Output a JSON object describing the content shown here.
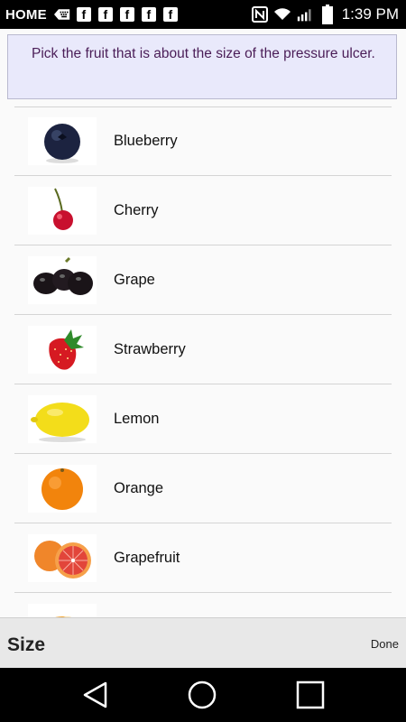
{
  "status_bar": {
    "home_label": "HOME",
    "time": "1:39 PM",
    "icons": [
      "keyboard-icon",
      "facebook-icon",
      "facebook-icon",
      "facebook-icon",
      "facebook-icon",
      "facebook-icon",
      "nfc-icon",
      "wifi-icon",
      "signal-icon",
      "battery-icon"
    ]
  },
  "prompt": {
    "text": "Pick the fruit that is about the size of the pressure ulcer."
  },
  "fruits": [
    {
      "label": "Blueberry",
      "icon": "blueberry-icon"
    },
    {
      "label": "Cherry",
      "icon": "cherry-icon"
    },
    {
      "label": "Grape",
      "icon": "grape-icon"
    },
    {
      "label": "Strawberry",
      "icon": "strawberry-icon"
    },
    {
      "label": "Lemon",
      "icon": "lemon-icon"
    },
    {
      "label": "Orange",
      "icon": "orange-icon"
    },
    {
      "label": "Grapefruit",
      "icon": "grapefruit-icon"
    }
  ],
  "bottom_bar": {
    "title": "Size",
    "done_label": "Done"
  },
  "nav_bar": {
    "icons": [
      "back-icon",
      "home-icon",
      "recents-icon"
    ]
  }
}
